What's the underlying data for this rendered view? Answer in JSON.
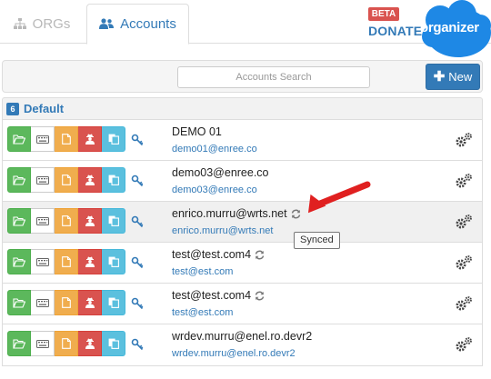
{
  "tabs": [
    {
      "label": "ORGs",
      "icon": "sitemap-icon",
      "active": false
    },
    {
      "label": "Accounts",
      "icon": "users-icon",
      "active": true
    }
  ],
  "header": {
    "beta_badge": "BETA",
    "donate_label": "DONATE",
    "logo_text": "organizer"
  },
  "toolbar": {
    "search_placeholder": "Accounts Search",
    "new_label": "New"
  },
  "group": {
    "count": "6",
    "name": "Default"
  },
  "accounts": [
    {
      "name": "DEMO 01",
      "username": "demo01@enree.co",
      "synced": false
    },
    {
      "name": "demo03@enree.co",
      "username": "demo03@enree.co",
      "synced": false
    },
    {
      "name": "enrico.murru@wrts.net",
      "username": "enrico.murru@wrts.net",
      "synced": true
    },
    {
      "name": "test@test.com4",
      "username": "test@est.com",
      "synced": true
    },
    {
      "name": "test@test.com4",
      "username": "test@est.com",
      "synced": true
    },
    {
      "name": "wrdev.murru@enel.ro.devr2",
      "username": "wrdev.murru@enel.ro.devr2",
      "synced": false
    }
  ],
  "tooltip": {
    "text": "Synced"
  },
  "colors": {
    "primary": "#337ab7",
    "success": "#5cb85c",
    "warning": "#f0ad4e",
    "danger": "#d9534f",
    "info": "#5bc0de",
    "logo": "#1e88e5",
    "annotation_arrow": "#e02020"
  }
}
